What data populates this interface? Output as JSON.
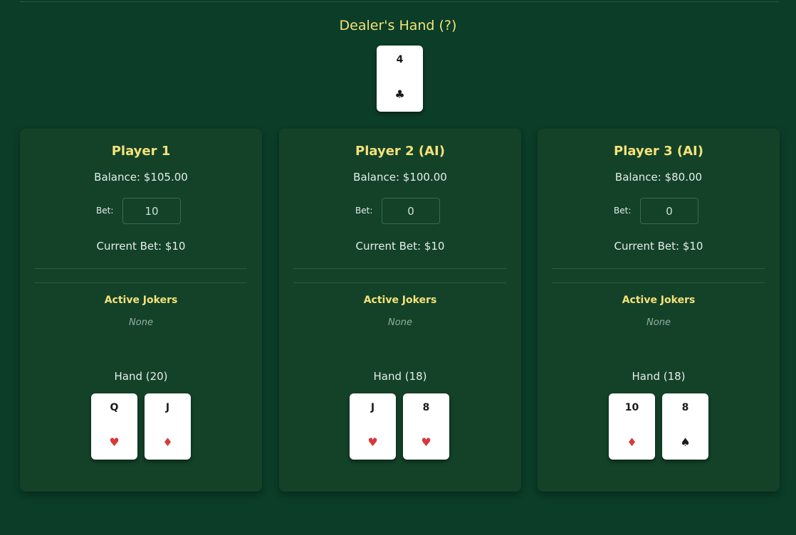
{
  "dealer": {
    "title": "Dealer's Hand (?)",
    "cards": [
      {
        "rank": "4",
        "suit": "♣",
        "color": "black"
      }
    ]
  },
  "players": [
    {
      "name": "Player 1",
      "balance": "Balance: $105.00",
      "bet_label": "Bet:",
      "bet_value": "10",
      "current_bet": "Current Bet: $10",
      "jokers_title": "Active Jokers",
      "jokers_value": "None",
      "hand_title": "Hand (20)",
      "cards": [
        {
          "rank": "Q",
          "suit": "♥",
          "color": "red"
        },
        {
          "rank": "J",
          "suit": "♦",
          "color": "red"
        }
      ]
    },
    {
      "name": "Player 2 (AI)",
      "balance": "Balance: $100.00",
      "bet_label": "Bet:",
      "bet_value": "0",
      "current_bet": "Current Bet: $10",
      "jokers_title": "Active Jokers",
      "jokers_value": "None",
      "hand_title": "Hand (18)",
      "cards": [
        {
          "rank": "J",
          "suit": "♥",
          "color": "red"
        },
        {
          "rank": "8",
          "suit": "♥",
          "color": "red"
        }
      ]
    },
    {
      "name": "Player 3 (AI)",
      "balance": "Balance: $80.00",
      "bet_label": "Bet:",
      "bet_value": "0",
      "current_bet": "Current Bet: $10",
      "jokers_title": "Active Jokers",
      "jokers_value": "None",
      "hand_title": "Hand (18)",
      "cards": [
        {
          "rank": "10",
          "suit": "♦",
          "color": "red"
        },
        {
          "rank": "8",
          "suit": "♠",
          "color": "black"
        }
      ]
    }
  ],
  "colors": {
    "table": "#0b3d28",
    "panel": "#134229",
    "accent": "#f5e27a",
    "red_suit": "#d63a3a"
  }
}
